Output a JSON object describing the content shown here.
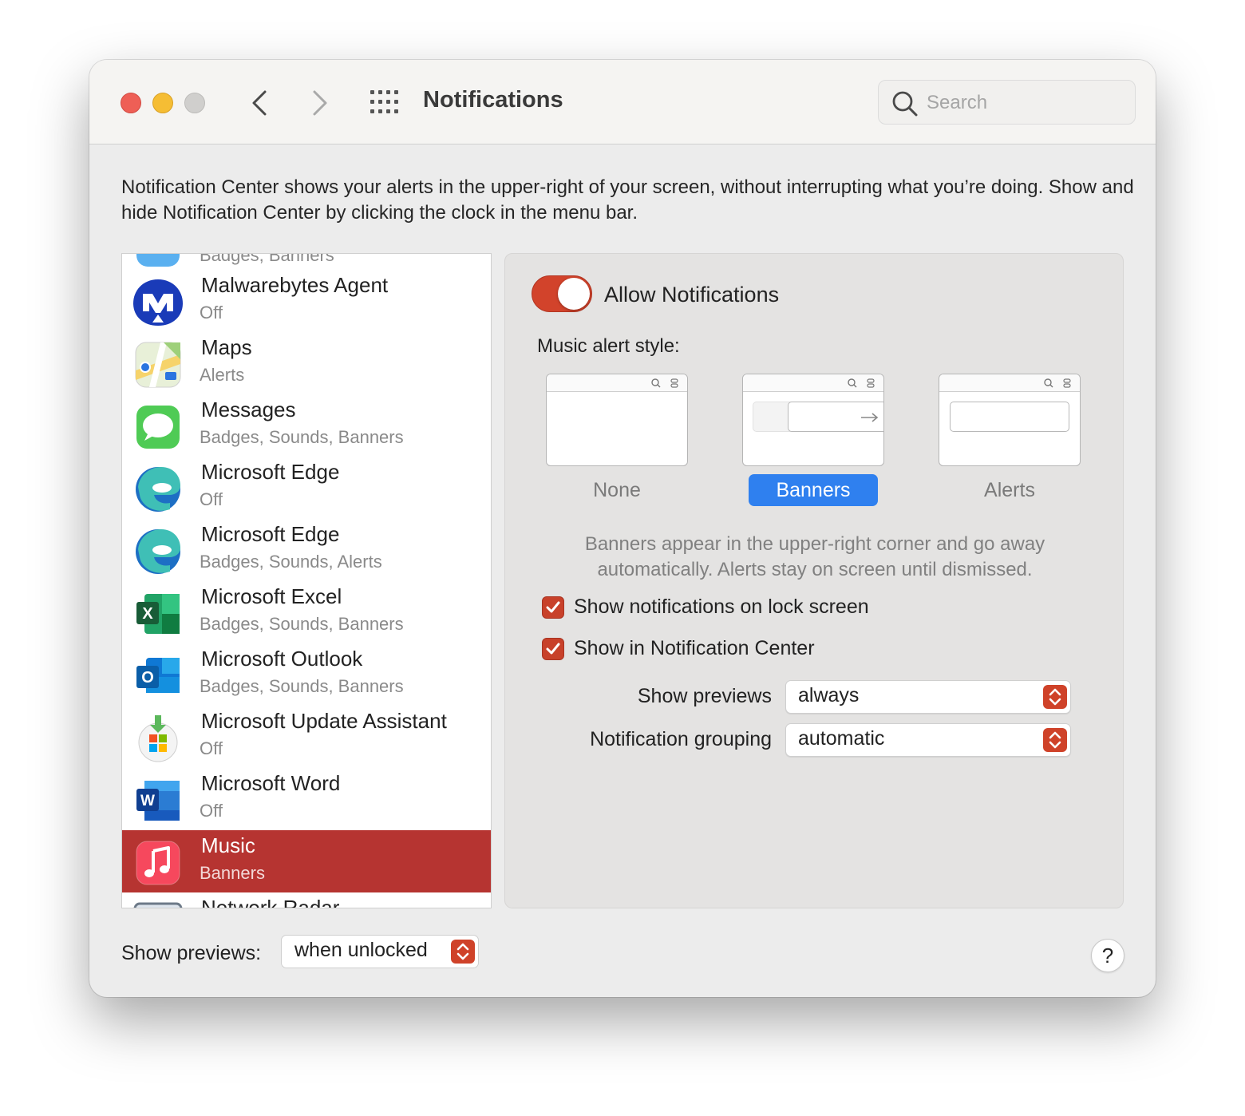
{
  "window": {
    "title": "Notifications",
    "search_placeholder": "Search"
  },
  "description": "Notification Center shows your alerts in the upper-right of your screen, without interrupting what you’re doing. Show and hide Notification Center by clicking the clock in the menu bar.",
  "apps": [
    {
      "name": "",
      "status": "Badges, Banners",
      "icon": "partial-app-icon"
    },
    {
      "name": "Malwarebytes Agent",
      "status": "Off",
      "icon": "malwarebytes-icon"
    },
    {
      "name": "Maps",
      "status": "Alerts",
      "icon": "maps-icon"
    },
    {
      "name": "Messages",
      "status": "Badges, Sounds, Banners",
      "icon": "messages-icon"
    },
    {
      "name": "Microsoft Edge",
      "status": "Off",
      "icon": "edge-icon"
    },
    {
      "name": "Microsoft Edge",
      "status": "Badges, Sounds, Alerts",
      "icon": "edge-icon"
    },
    {
      "name": "Microsoft Excel",
      "status": "Badges, Sounds, Banners",
      "icon": "excel-icon"
    },
    {
      "name": "Microsoft Outlook",
      "status": "Badges, Sounds, Banners",
      "icon": "outlook-icon"
    },
    {
      "name": "Microsoft Update Assistant",
      "status": "Off",
      "icon": "update-assistant-icon"
    },
    {
      "name": "Microsoft Word",
      "status": "Off",
      "icon": "word-icon"
    },
    {
      "name": "Music",
      "status": "Banners",
      "icon": "music-icon",
      "selected": true
    },
    {
      "name": "Network Radar",
      "status": "",
      "icon": "network-radar-icon"
    }
  ],
  "detail": {
    "allow_label": "Allow Notifications",
    "allow_enabled": true,
    "alert_style_label": "Music alert style:",
    "styles": [
      "None",
      "Banners",
      "Alerts"
    ],
    "selected_style": "Banners",
    "style_description": "Banners appear in the upper-right corner and go away automatically. Alerts stay on screen until dismissed.",
    "lock_screen_label": "Show notifications on lock screen",
    "lock_screen_checked": true,
    "center_label": "Show in Notification Center",
    "center_checked": true,
    "previews_label": "Show previews",
    "previews_value": "always",
    "grouping_label": "Notification grouping",
    "grouping_value": "automatic"
  },
  "footer": {
    "previews_label": "Show previews:",
    "previews_value": "when unlocked",
    "help_label": "?"
  },
  "colors": {
    "accent": "#2f80ef",
    "selection": "#b63431",
    "toggle": "#d2432b"
  }
}
